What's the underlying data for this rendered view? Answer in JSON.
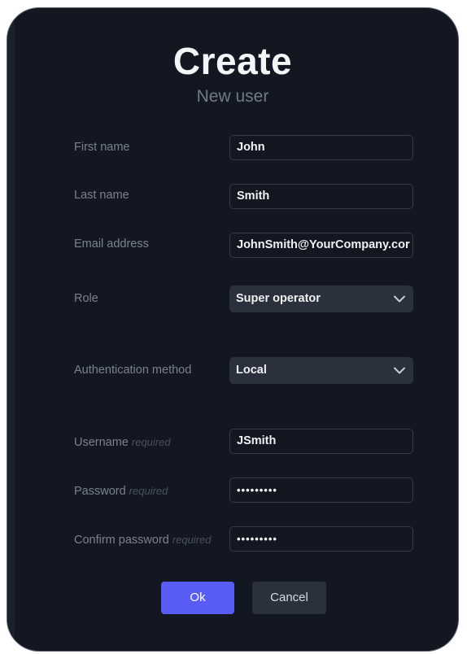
{
  "dialog": {
    "title": "Create",
    "subtitle": "New user"
  },
  "form": {
    "required_hint": "required",
    "first_name": {
      "label": "First name",
      "value": "John"
    },
    "last_name": {
      "label": "Last name",
      "value": "Smith"
    },
    "email": {
      "label": "Email address",
      "value": "JohnSmith@YourCompany.cor"
    },
    "role": {
      "label": "Role",
      "selected": "Super operator"
    },
    "auth_method": {
      "label": "Authentication method",
      "selected": "Local"
    },
    "username": {
      "label": "Username",
      "value": "JSmith"
    },
    "password": {
      "label": "Password",
      "value": "•••••••••"
    },
    "confirm_password": {
      "label": "Confirm password",
      "value": "•••••••••"
    }
  },
  "buttons": {
    "ok": "Ok",
    "cancel": "Cancel"
  },
  "colors": {
    "background": "#121722",
    "primary": "#5a5cf6",
    "secondary_button": "#2a303c",
    "label": "#7b828e",
    "required_hint": "#4a515e"
  },
  "icons": {
    "select_arrow": "chevron-down-icon"
  }
}
